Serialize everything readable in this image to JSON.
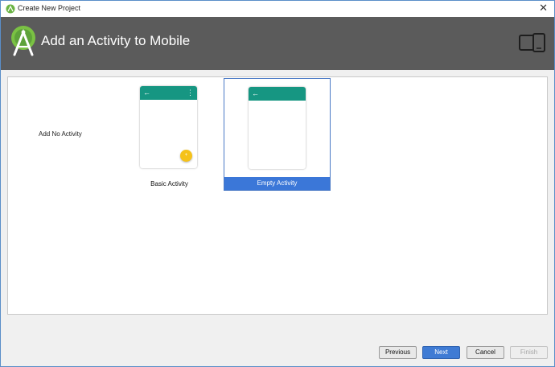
{
  "window": {
    "title": "Create New Project",
    "close_glyph": "✕",
    "accent_border": "#5a8ec8"
  },
  "header": {
    "title": "Add an Activity to Mobile",
    "background": "#5b5b5b",
    "logo_icon": "android-studio-icon",
    "device_icon": "phone-tablet-icon"
  },
  "activities": {
    "none_label": "Add No Activity",
    "items": [
      {
        "label": "Basic Activity",
        "selected": false,
        "has_fab": true,
        "has_menu": true
      },
      {
        "label": "Empty Activity",
        "selected": true,
        "has_fab": false,
        "has_menu": false
      }
    ],
    "appbar_color": "#169682",
    "fab_color": "#f5c21a",
    "selected_color": "#3b77d8",
    "back_glyph": "←",
    "menu_glyph": "⋮",
    "fab_glyph": "+"
  },
  "footer": {
    "previous_label": "Previous",
    "next_label": "Next",
    "cancel_label": "Cancel",
    "finish_label": "Finish",
    "finish_enabled": false
  }
}
